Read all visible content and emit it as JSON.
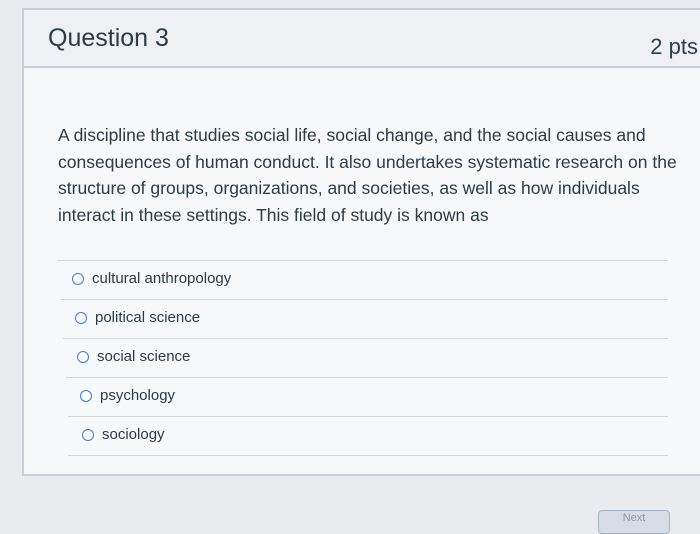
{
  "question": {
    "title": "Question 3",
    "points": "2 pts",
    "text": "A discipline that studies social life, social change, and the social causes and consequences of human conduct. It also undertakes systematic research on the structure of groups, organizations, and societies, as well as how individuals interact in these settings. This field of study is known as"
  },
  "answers": [
    {
      "label": "cultural anthropology"
    },
    {
      "label": "political science"
    },
    {
      "label": "social science"
    },
    {
      "label": "psychology"
    },
    {
      "label": "sociology"
    }
  ],
  "footer": {
    "next_label": "Next"
  },
  "colors": {
    "radio_border": "#3a7bd5",
    "text": "#2d3b45"
  }
}
